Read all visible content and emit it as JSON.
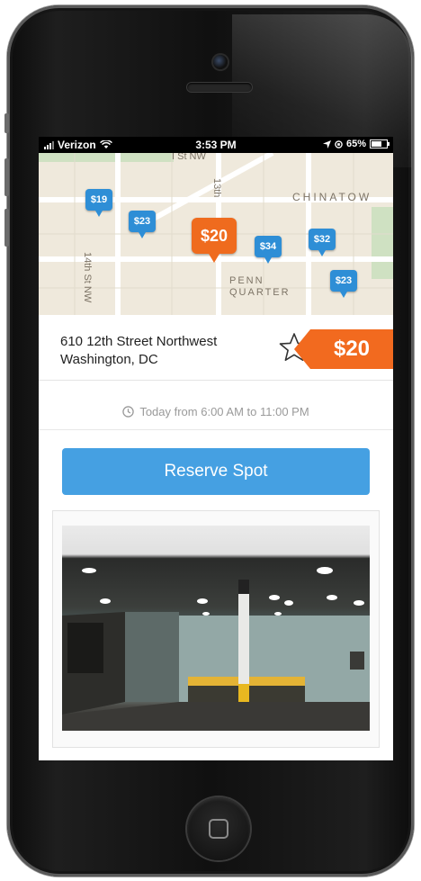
{
  "status_bar": {
    "carrier": "Verizon",
    "time": "3:53 PM",
    "battery": "65%"
  },
  "map": {
    "neighborhood": "CHINATOW",
    "streets": [
      "14th St NW",
      "13th",
      "I St NW"
    ],
    "district": "PENN QUARTER",
    "pins": [
      "$19",
      "$23",
      "$34",
      "$32",
      "$23",
      "$20"
    ],
    "selected_pin": "$20"
  },
  "spot": {
    "address_line1": "610 12th Street Northwest",
    "address_line2": "Washington, DC",
    "price": "$20",
    "hours": "Today from 6:00 AM to 11:00 PM"
  },
  "actions": {
    "reserve_label": "Reserve Spot"
  },
  "colors": {
    "accent_blue": "#45a0e2",
    "price_orange": "#f26a1f",
    "map_pin_blue": "#2e8ed6"
  },
  "icons": {
    "favorite": "star-icon",
    "hours": "clock-icon",
    "wifi": "wifi-icon",
    "location": "location-arrow-icon"
  }
}
